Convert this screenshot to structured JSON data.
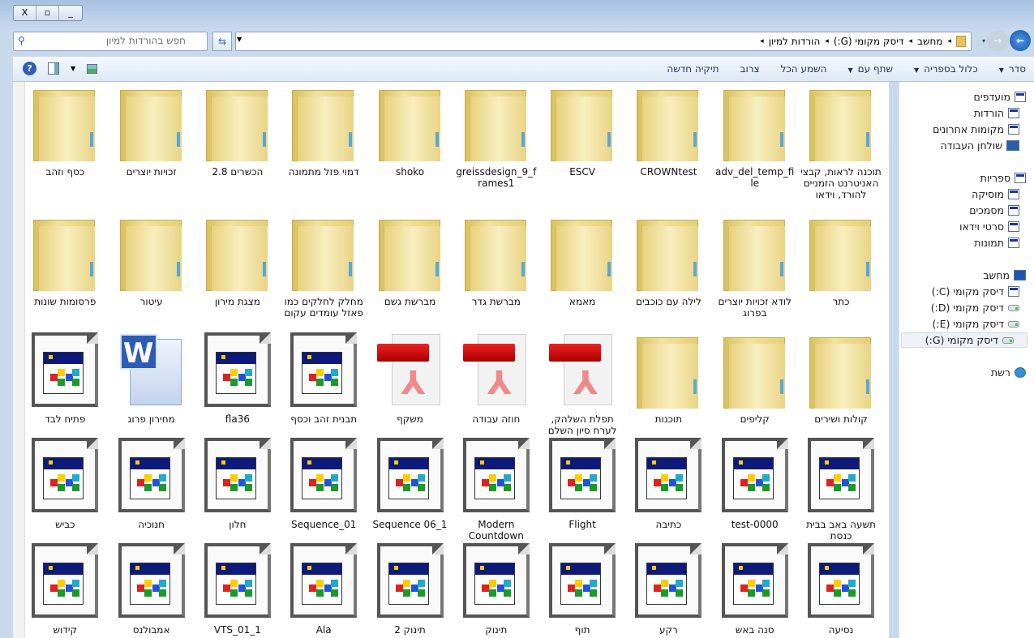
{
  "window": {
    "close": "X",
    "restore": "▫",
    "minimize": "_"
  },
  "address": {
    "crumbs": [
      "מחשב",
      "דיסק מקומי (G:)",
      "הורדות למיון"
    ],
    "separator": "◂"
  },
  "search": {
    "placeholder": "חפש בהורדות למיון"
  },
  "toolbar": {
    "organize": "סדר",
    "include_library": "כלול בספריה",
    "share_with": "שתף עם",
    "play_all": "השמע הכל",
    "burn": "צרוב",
    "new_folder": "תיקיה חדשה",
    "help": "?"
  },
  "sidebar": {
    "favorites": {
      "title": "מועדפים",
      "items": [
        "הורדות",
        "מקומות אחרונים",
        "שולחן העבודה"
      ]
    },
    "libraries": {
      "title": "ספריות",
      "items": [
        "מוסיקה",
        "מסמכים",
        "סרטי וידאו",
        "תמונות"
      ]
    },
    "computer": {
      "title": "מחשב",
      "items": [
        "דיסק מקומי (C:)",
        "דיסק מקומי (D:)",
        "דיסק מקומי (E:)",
        "דיסק מקומי (G:)"
      ],
      "selected": "דיסק מקומי (G:)"
    },
    "network": {
      "title": "רשת"
    }
  },
  "items": [
    {
      "name": "תוכנה לראות, קבצי האניטרנט הזמניים להורד, וידאו",
      "type": "folder"
    },
    {
      "name": "adv_del_temp_file",
      "type": "folder"
    },
    {
      "name": "CROWNtest",
      "type": "folder"
    },
    {
      "name": "ESCV",
      "type": "folder"
    },
    {
      "name": "greissdesign_9_frames1",
      "type": "folder"
    },
    {
      "name": "shoko",
      "type": "folder"
    },
    {
      "name": "דמוי פזל מתמונה",
      "type": "folder"
    },
    {
      "name": "הכשרים 2.8",
      "type": "folder"
    },
    {
      "name": "זכויות יוצרים",
      "type": "folder"
    },
    {
      "name": "כסף וזהב",
      "type": "folder"
    },
    {
      "name": "כתר",
      "type": "folder"
    },
    {
      "name": "לודא זכויות יוצרים בפרוג",
      "type": "folder"
    },
    {
      "name": "לילה עם כוכבים",
      "type": "folder"
    },
    {
      "name": "מאמא",
      "type": "folder"
    },
    {
      "name": "מברשת גדר",
      "type": "folder"
    },
    {
      "name": "מברשת גשם",
      "type": "folder"
    },
    {
      "name": "מחלק לחלקים כמו פאזל עומדים עקום",
      "type": "folder"
    },
    {
      "name": "מצגת מירון",
      "type": "folder"
    },
    {
      "name": "עיטור",
      "type": "folder"
    },
    {
      "name": "פרסומות שונות",
      "type": "folder"
    },
    {
      "name": "קולות ושירים",
      "type": "folder"
    },
    {
      "name": "קליפים",
      "type": "folder"
    },
    {
      "name": "תוכנות",
      "type": "folder"
    },
    {
      "name": "תפלת השלהק, לערח סיון השלם",
      "type": "pdf"
    },
    {
      "name": "חוזה עבודה",
      "type": "pdf"
    },
    {
      "name": "משקף",
      "type": "pdf"
    },
    {
      "name": "תבנית זהב וכסף",
      "type": "app"
    },
    {
      "name": "fla36",
      "type": "app"
    },
    {
      "name": "מחירון פרוג",
      "type": "word"
    },
    {
      "name": "פתיח לבד",
      "type": "app"
    },
    {
      "name": "תשעה באב בבית כנסת",
      "type": "app"
    },
    {
      "name": "test-0000",
      "type": "app"
    },
    {
      "name": "כתיבה",
      "type": "app"
    },
    {
      "name": "Flight",
      "type": "app"
    },
    {
      "name": "Modern Countdown",
      "type": "app"
    },
    {
      "name": "Sequence 06_1",
      "type": "app"
    },
    {
      "name": "Sequence_01",
      "type": "app"
    },
    {
      "name": "חלון",
      "type": "app"
    },
    {
      "name": "חנוכיה",
      "type": "app"
    },
    {
      "name": "כביש",
      "type": "app"
    },
    {
      "name": "נסיעה",
      "type": "app"
    },
    {
      "name": "סנה באש",
      "type": "app"
    },
    {
      "name": "רקע",
      "type": "app"
    },
    {
      "name": "תוף",
      "type": "app"
    },
    {
      "name": "תינוק",
      "type": "app"
    },
    {
      "name": "תינוק 2",
      "type": "app"
    },
    {
      "name": "Ala",
      "type": "app"
    },
    {
      "name": "VTS_01_1",
      "type": "app"
    },
    {
      "name": "אמבולנס",
      "type": "app"
    },
    {
      "name": "קידוש",
      "type": "app"
    }
  ]
}
